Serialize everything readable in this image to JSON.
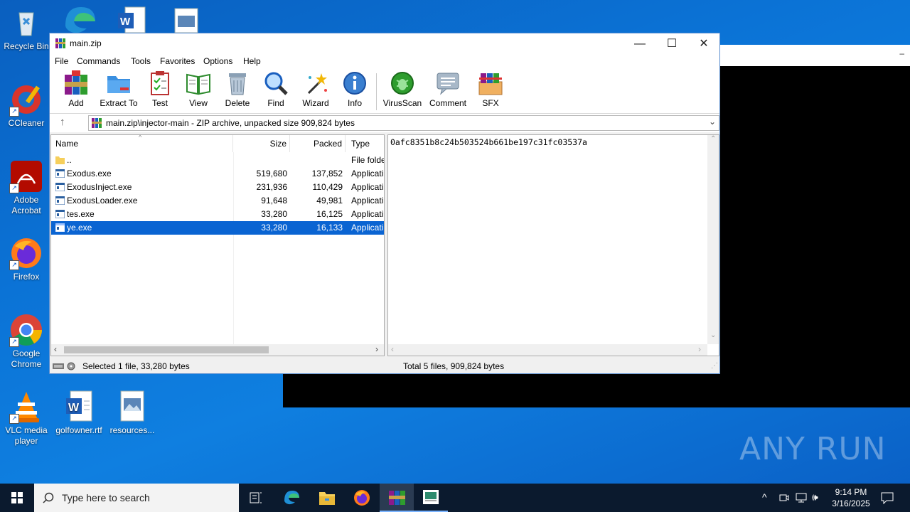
{
  "desktop": {
    "icons": [
      {
        "label": "Recycle Bin"
      },
      {
        "label": "CCleaner"
      },
      {
        "label": "Adobe Acrobat"
      },
      {
        "label": "Firefox"
      },
      {
        "label": "Google Chrome"
      },
      {
        "label": "VLC media player"
      },
      {
        "label": "golfowner.rtf"
      },
      {
        "label": "resources..."
      }
    ]
  },
  "window": {
    "title": "main.zip",
    "controls": {
      "minimize": "—",
      "maximize": "☐",
      "close": "✕"
    }
  },
  "menu": [
    "File",
    "Commands",
    "Tools",
    "Favorites",
    "Options",
    "Help"
  ],
  "toolbar": [
    {
      "label": "Add",
      "icon": "add-icon"
    },
    {
      "label": "Extract To",
      "icon": "extract-to-icon"
    },
    {
      "label": "Test",
      "icon": "test-icon"
    },
    {
      "label": "View",
      "icon": "view-icon"
    },
    {
      "label": "Delete",
      "icon": "delete-icon"
    },
    {
      "label": "Find",
      "icon": "find-icon"
    },
    {
      "label": "Wizard",
      "icon": "wizard-icon"
    },
    {
      "label": "Info",
      "icon": "info-icon"
    },
    {
      "label": "VirusScan",
      "icon": "virusscan-icon"
    },
    {
      "label": "Comment",
      "icon": "comment-icon"
    },
    {
      "label": "SFX",
      "icon": "sfx-icon"
    }
  ],
  "address": {
    "path": "main.zip\\injector-main - ZIP archive, unpacked size 909,824 bytes"
  },
  "columns": {
    "name": "Name",
    "size": "Size",
    "packed": "Packed",
    "type": "Type"
  },
  "files": [
    {
      "name": "..",
      "size": "",
      "packed": "",
      "type": "File folde",
      "selected": false,
      "folder": true
    },
    {
      "name": "Exodus.exe",
      "size": "519,680",
      "packed": "137,852",
      "type": "Applicati",
      "selected": false,
      "folder": false
    },
    {
      "name": "ExodusInject.exe",
      "size": "231,936",
      "packed": "110,429",
      "type": "Applicati",
      "selected": false,
      "folder": false
    },
    {
      "name": "ExodusLoader.exe",
      "size": "91,648",
      "packed": "49,981",
      "type": "Applicati",
      "selected": false,
      "folder": false
    },
    {
      "name": "tes.exe",
      "size": "33,280",
      "packed": "16,125",
      "type": "Applicati",
      "selected": false,
      "folder": false
    },
    {
      "name": "ye.exe",
      "size": "33,280",
      "packed": "16,133",
      "type": "Applicati",
      "selected": true,
      "folder": false
    }
  ],
  "comment": {
    "text": "0afc8351b8c24b503524b661be197c31fc03537a"
  },
  "status": {
    "left": "Selected 1 file, 33,280 bytes",
    "right": "Total 5 files, 909,824 bytes"
  },
  "taskbar": {
    "search_placeholder": "Type here to search",
    "time": "9:14 PM",
    "date": "3/16/2025"
  },
  "watermark": "ANY RUN"
}
